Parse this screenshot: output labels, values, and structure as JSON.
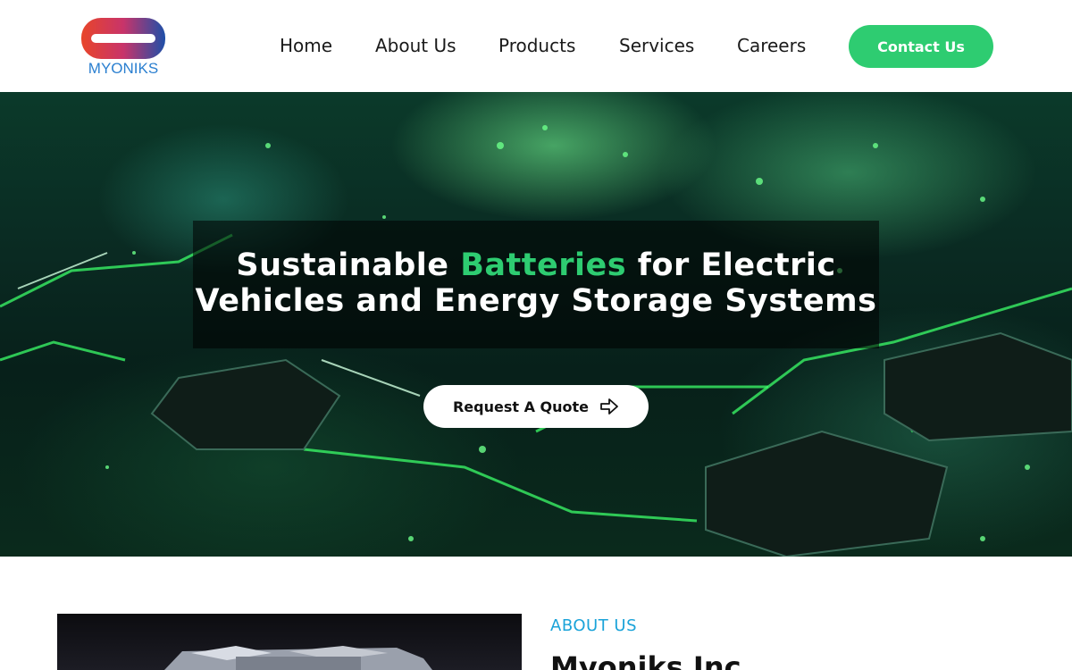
{
  "header": {
    "logo_text": "MYONIKS",
    "nav": {
      "home": "Home",
      "about": "About Us",
      "products": "Products",
      "services": "Services",
      "careers": "Careers"
    },
    "contact_label": "Contact Us"
  },
  "hero": {
    "title_part1": "Sustainable ",
    "title_accent": "Batteries",
    "title_part2": " for Electric Vehicles and Energy Storage Systems",
    "quote_label": "Request A Quote",
    "quote_icon": "arrow-right-icon"
  },
  "about": {
    "label": "ABOUT US",
    "title": "Myoniks Inc"
  },
  "colors": {
    "accent_green": "#2ecc71",
    "about_label_blue": "#1aa3d9",
    "logo_red": "#e8452a",
    "logo_blue": "#1e4fa8"
  }
}
